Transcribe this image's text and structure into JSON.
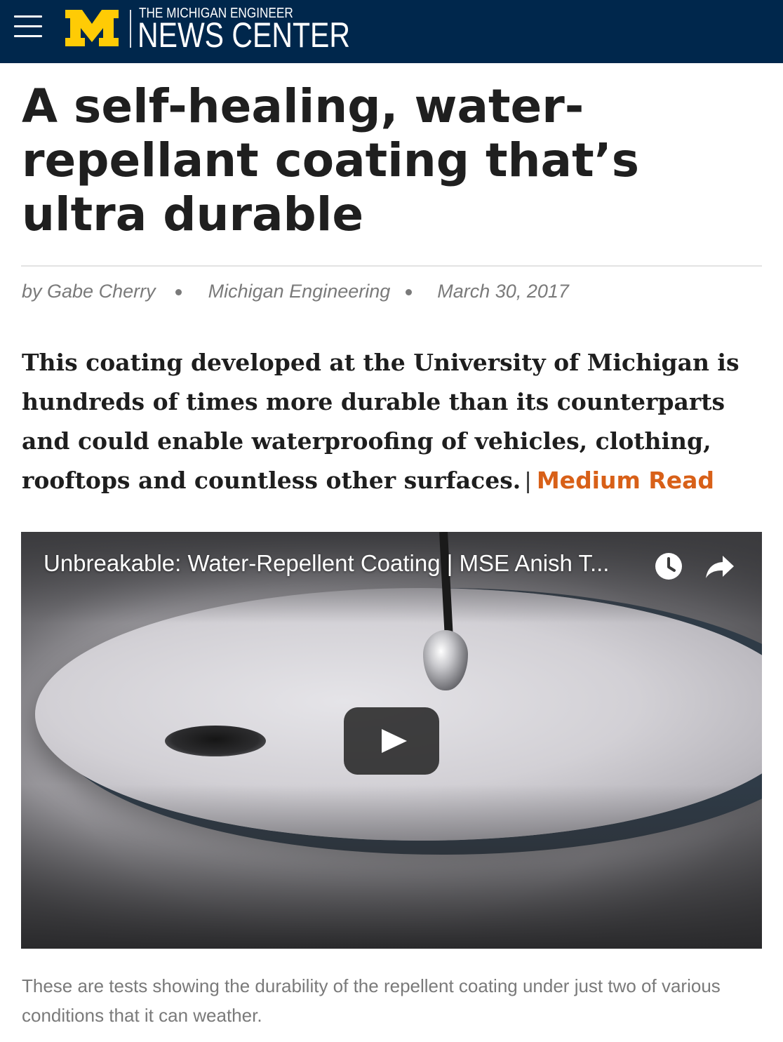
{
  "header": {
    "menu_icon": "hamburger-menu-icon",
    "logo_letter": "M",
    "logo_small": "THE MICHIGAN ENGINEER",
    "logo_big": "NEWS CENTER",
    "colors": {
      "bar": "#00274c",
      "maize": "#ffcb05"
    }
  },
  "article": {
    "headline": "A self-healing, water-repellant coating that’s ultra durable",
    "byline": {
      "author": "by Gabe Cherry",
      "source": "Michigan Engineering",
      "date": "March 30, 2017"
    },
    "summary": "This coating developed at the University of Michigan is hundreds of times more durable than its counterparts and could enable waterproofing of vehicles, clothing, rooftops and countless other surfaces.",
    "separator": "|",
    "read_time": "Medium Read",
    "accent_color": "#d86018"
  },
  "video": {
    "title": "Unbreakable: Water-Repellent Coating | MSE Anish T...",
    "watch_later_icon": "clock-icon",
    "share_icon": "share-arrow-icon",
    "play_icon": "play-button-icon"
  },
  "caption": "These are tests showing the durability of the repellent coating under just two of various conditions that it can weather."
}
